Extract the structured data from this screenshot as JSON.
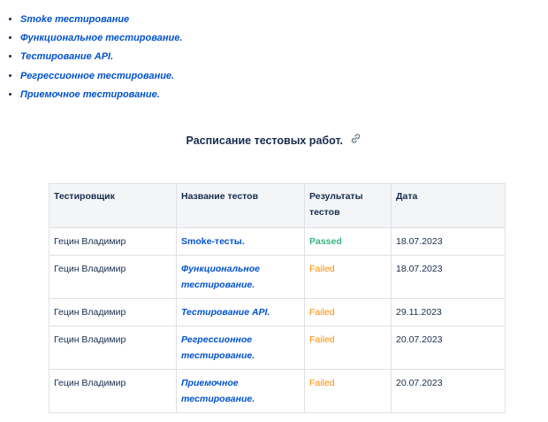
{
  "bullets": [
    "Smoke тестирование",
    "Функциональное тестирование.",
    "Тестирование API.",
    "Регрессионное тестирование.",
    "Приемочное тестирование."
  ],
  "heading": "Расписание тестовых работ.",
  "table": {
    "headers": [
      "Тестировщик",
      "Название тестов",
      "Результаты тестов",
      "Дата"
    ],
    "rows": [
      {
        "tester": "Гецин Владимир",
        "test": "Smoke-тесты.",
        "result": "Passed",
        "date": "18.07.2023"
      },
      {
        "tester": "Гецин Владимир",
        "test": "Функциональное тестирование.",
        "result": "Failed",
        "date": "18.07.2023"
      },
      {
        "tester": "Гецин Владимир",
        "test": "Тестирование API.",
        "result": "Failed",
        "date": "29.11.2023"
      },
      {
        "tester": "Гецин Владимир",
        "test": "Регрессионное тестирование.",
        "result": "Failed",
        "date": "20.07.2023"
      },
      {
        "tester": "Гецин Владимир",
        "test": "Приемочное тестирование.",
        "result": "Failed",
        "date": "20.07.2023"
      }
    ]
  },
  "colors": {
    "link": "#0052cc",
    "passed": "#36b37e",
    "failed": "#ff8b00"
  },
  "icons": {
    "heading_anchor": "link-icon"
  }
}
